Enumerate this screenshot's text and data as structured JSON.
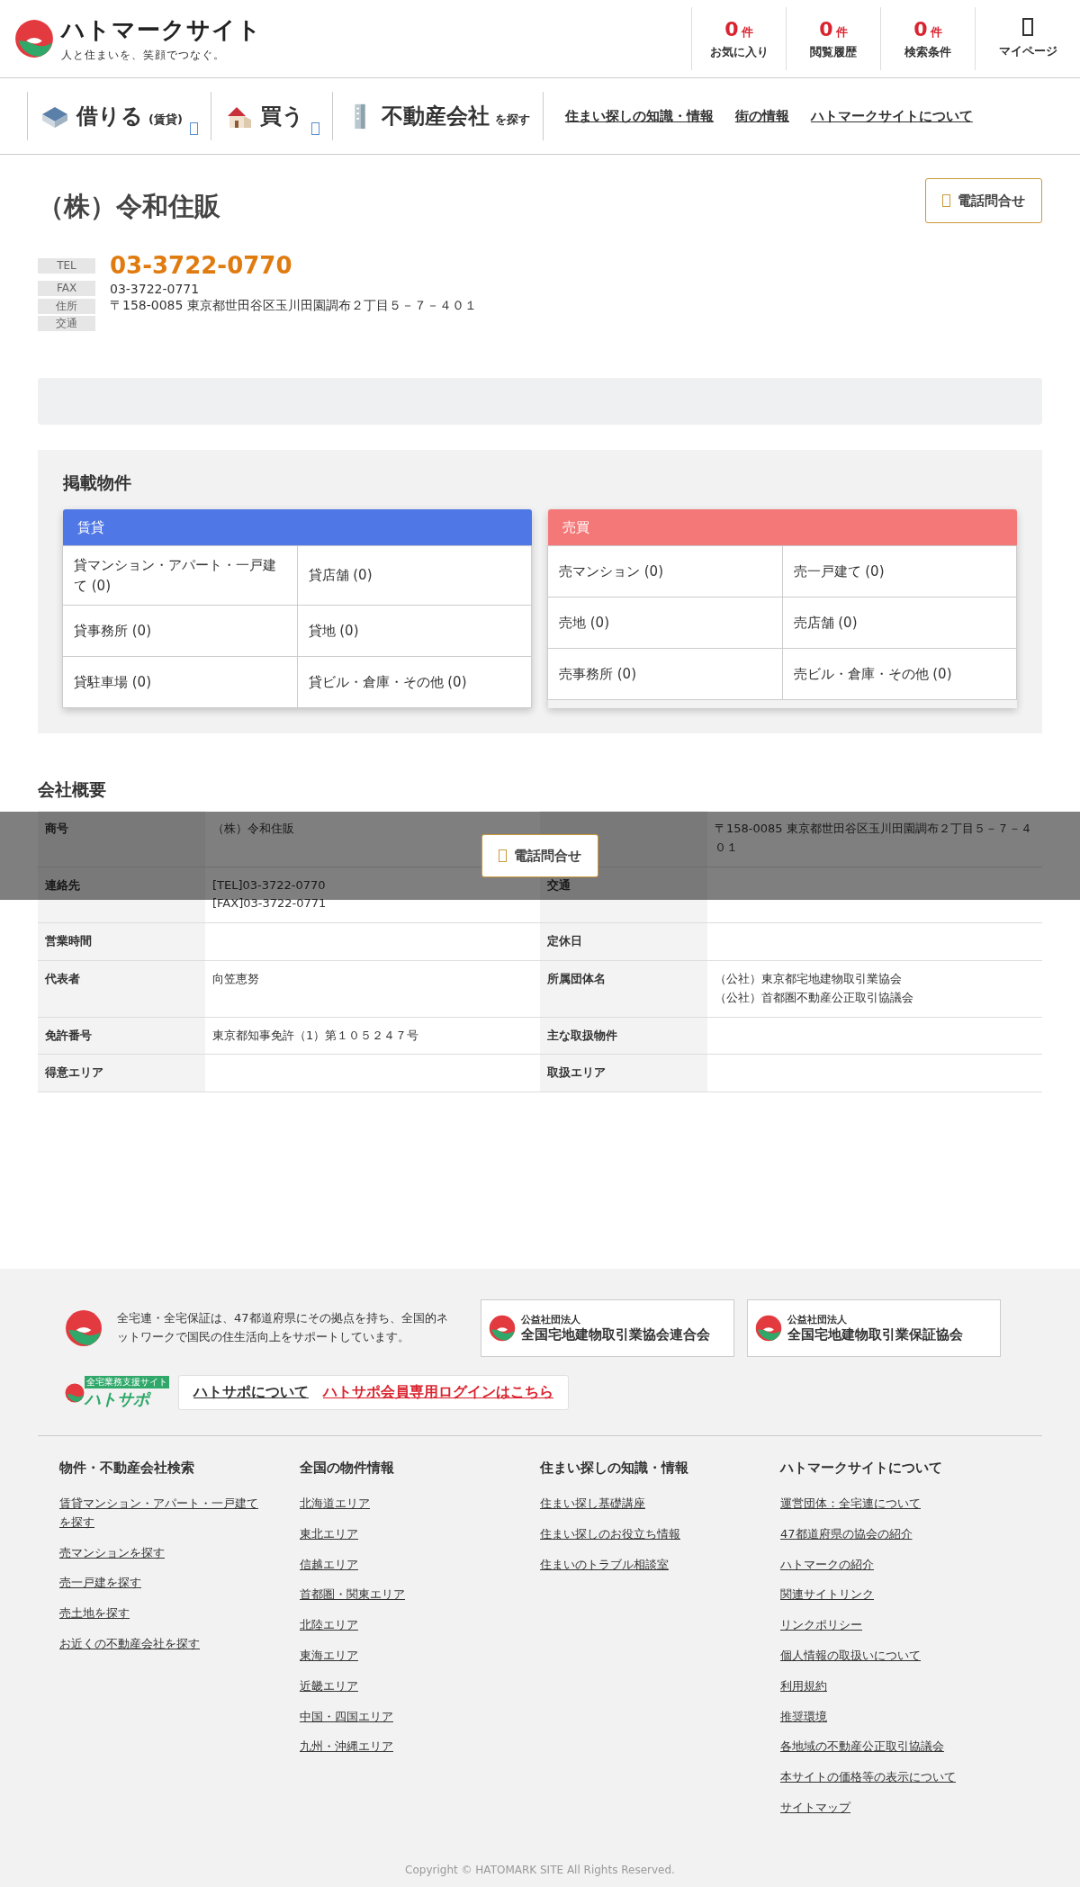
{
  "header": {
    "logo_title": "ハトマークサイト",
    "logo_tagline": "人と住まいを、笑顔でつなぐ。",
    "counters": [
      {
        "count": "0",
        "unit": "件",
        "label": "お気に入り"
      },
      {
        "count": "0",
        "unit": "件",
        "label": "閲覧履歴"
      },
      {
        "count": "0",
        "unit": "件",
        "label": "検索条件"
      }
    ],
    "mypage": "マイページ"
  },
  "nav": {
    "categories": [
      {
        "label": "借りる",
        "sub": "(賃貸)",
        "kind": "rent",
        "dropdown": true
      },
      {
        "label": "買う",
        "kind": "buy",
        "dropdown": true
      },
      {
        "label": "不動産会社",
        "sub": "を探す",
        "kind": "company",
        "dropdown": false
      }
    ],
    "links": [
      "住まい探しの知識・情報",
      "街の情報",
      "ハトマークサイトについて"
    ]
  },
  "company": {
    "name": "（株）令和住販",
    "call_button": "電話問合せ",
    "contacts": [
      {
        "label": "TEL",
        "value": "03-3722-0770",
        "kind": "tel"
      },
      {
        "label": "FAX",
        "value": "03-3722-0771",
        "kind": "plain"
      },
      {
        "label": "住所",
        "value": "〒158-0085 東京都世田谷区玉川田園調布２丁目５－７－４０１",
        "kind": "plain"
      },
      {
        "label": "交通"
      }
    ]
  },
  "listings": {
    "title": "掲載物件",
    "groups": [
      {
        "title": "賃貸",
        "color": "#4f77e6",
        "items": [
          "貸マンション・アパート・一戸建て (0)",
          "貸店舗 (0)",
          "貸事務所 (0)",
          "貸地 (0)",
          "貸駐車場 (0)",
          "貸ビル・倉庫・その他 (0)"
        ]
      },
      {
        "title": "売買",
        "color": "#f57878",
        "items": [
          "売マンション (0)",
          "売一戸建て (0)",
          "売地 (0)",
          "売店舗 (0)",
          "売事務所 (0)",
          "売ビル・倉庫・その他 (0)"
        ]
      }
    ]
  },
  "overview": {
    "title": "会社概要",
    "rows": [
      {
        "cells": [
          {
            "label": "商号",
            "value": [
              "（株）令和住販"
            ]
          },
          {
            "value": [
              "〒158-0085 東京都世田谷区玉川田園調布２丁目５－７－４０１"
            ]
          }
        ]
      },
      {
        "cells": [
          {
            "label": "連絡先",
            "value": [
              "[TEL]03-3722-0770",
              "[FAX]03-3722-0771"
            ]
          },
          {
            "label": "交通"
          }
        ]
      },
      {
        "cells": [
          {
            "label": "営業時間"
          },
          {
            "label": "定休日"
          }
        ]
      },
      {
        "cells": [
          {
            "label": "代表者",
            "value": [
              "向笠恵努"
            ]
          },
          {
            "label": "所属団体名",
            "value": [
              "（公社）東京都宅地建物取引業協会",
              "（公社）首都圏不動産公正取引協議会"
            ]
          }
        ]
      },
      {
        "cells": [
          {
            "label": "免許番号",
            "value": [
              "東京都知事免許（1）第１０５２４７号"
            ]
          },
          {
            "label": "主な取扱物件"
          }
        ]
      },
      {
        "cells": [
          {
            "label": "得意エリア"
          },
          {
            "label": "取扱エリア"
          }
        ]
      }
    ]
  },
  "overlay": {
    "call_button": "電話問合せ"
  },
  "footer": {
    "about": "全宅連・全宅保証は、47都道府県にその拠点を持ち、全国的ネットワークで国民の住生活向上をサポートしています。",
    "orgs": [
      {
        "small": "公益社団法人",
        "name": "全国宅地建物取引業協会連合会"
      },
      {
        "small": "公益社団法人",
        "name": "全国宅地建物取引業保証協会"
      }
    ],
    "hatosapo_logo": "ハトサポ",
    "hatosapo_tagline": "全宅業務支援サイト",
    "hatosapo_links": [
      {
        "label": "ハトサポについて",
        "kind": "plain"
      },
      {
        "label": "ハトサポ会員専用ログインはこちら",
        "kind": "alert"
      }
    ],
    "columns": [
      {
        "title": "物件・不動産会社検索",
        "links": [
          "賃貸マンション・アパート・一戸建てを探す",
          "売マンションを探す",
          "売一戸建を探す",
          "売土地を探す",
          "お近くの不動産会社を探す"
        ]
      },
      {
        "title": "全国の物件情報",
        "links": [
          "北海道エリア",
          "東北エリア",
          "信越エリア",
          "首都圏・関東エリア",
          "北陸エリア",
          "東海エリア",
          "近畿エリア",
          "中国・四国エリア",
          "九州・沖縄エリア"
        ]
      },
      {
        "title": "住まい探しの知識・情報",
        "links": [
          "住まい探し基礎講座",
          "住まい探しのお役立ち情報",
          "住まいのトラブル相談室"
        ]
      },
      {
        "title": "ハトマークサイトについて",
        "links": [
          "運営団体：全宅連について",
          "47都道府県の協会の紹介",
          "ハトマークの紹介",
          "関連サイトリンク",
          "リンクポリシー",
          "個人情報の取扱いについて",
          "利用規約",
          "推奨環境",
          "各地域の不動産公正取引協議会",
          "本サイトの価格等の表示について",
          "サイトマップ"
        ]
      }
    ],
    "copyright": "Copyright © HATOMARK SITE All Rights Reserved."
  }
}
